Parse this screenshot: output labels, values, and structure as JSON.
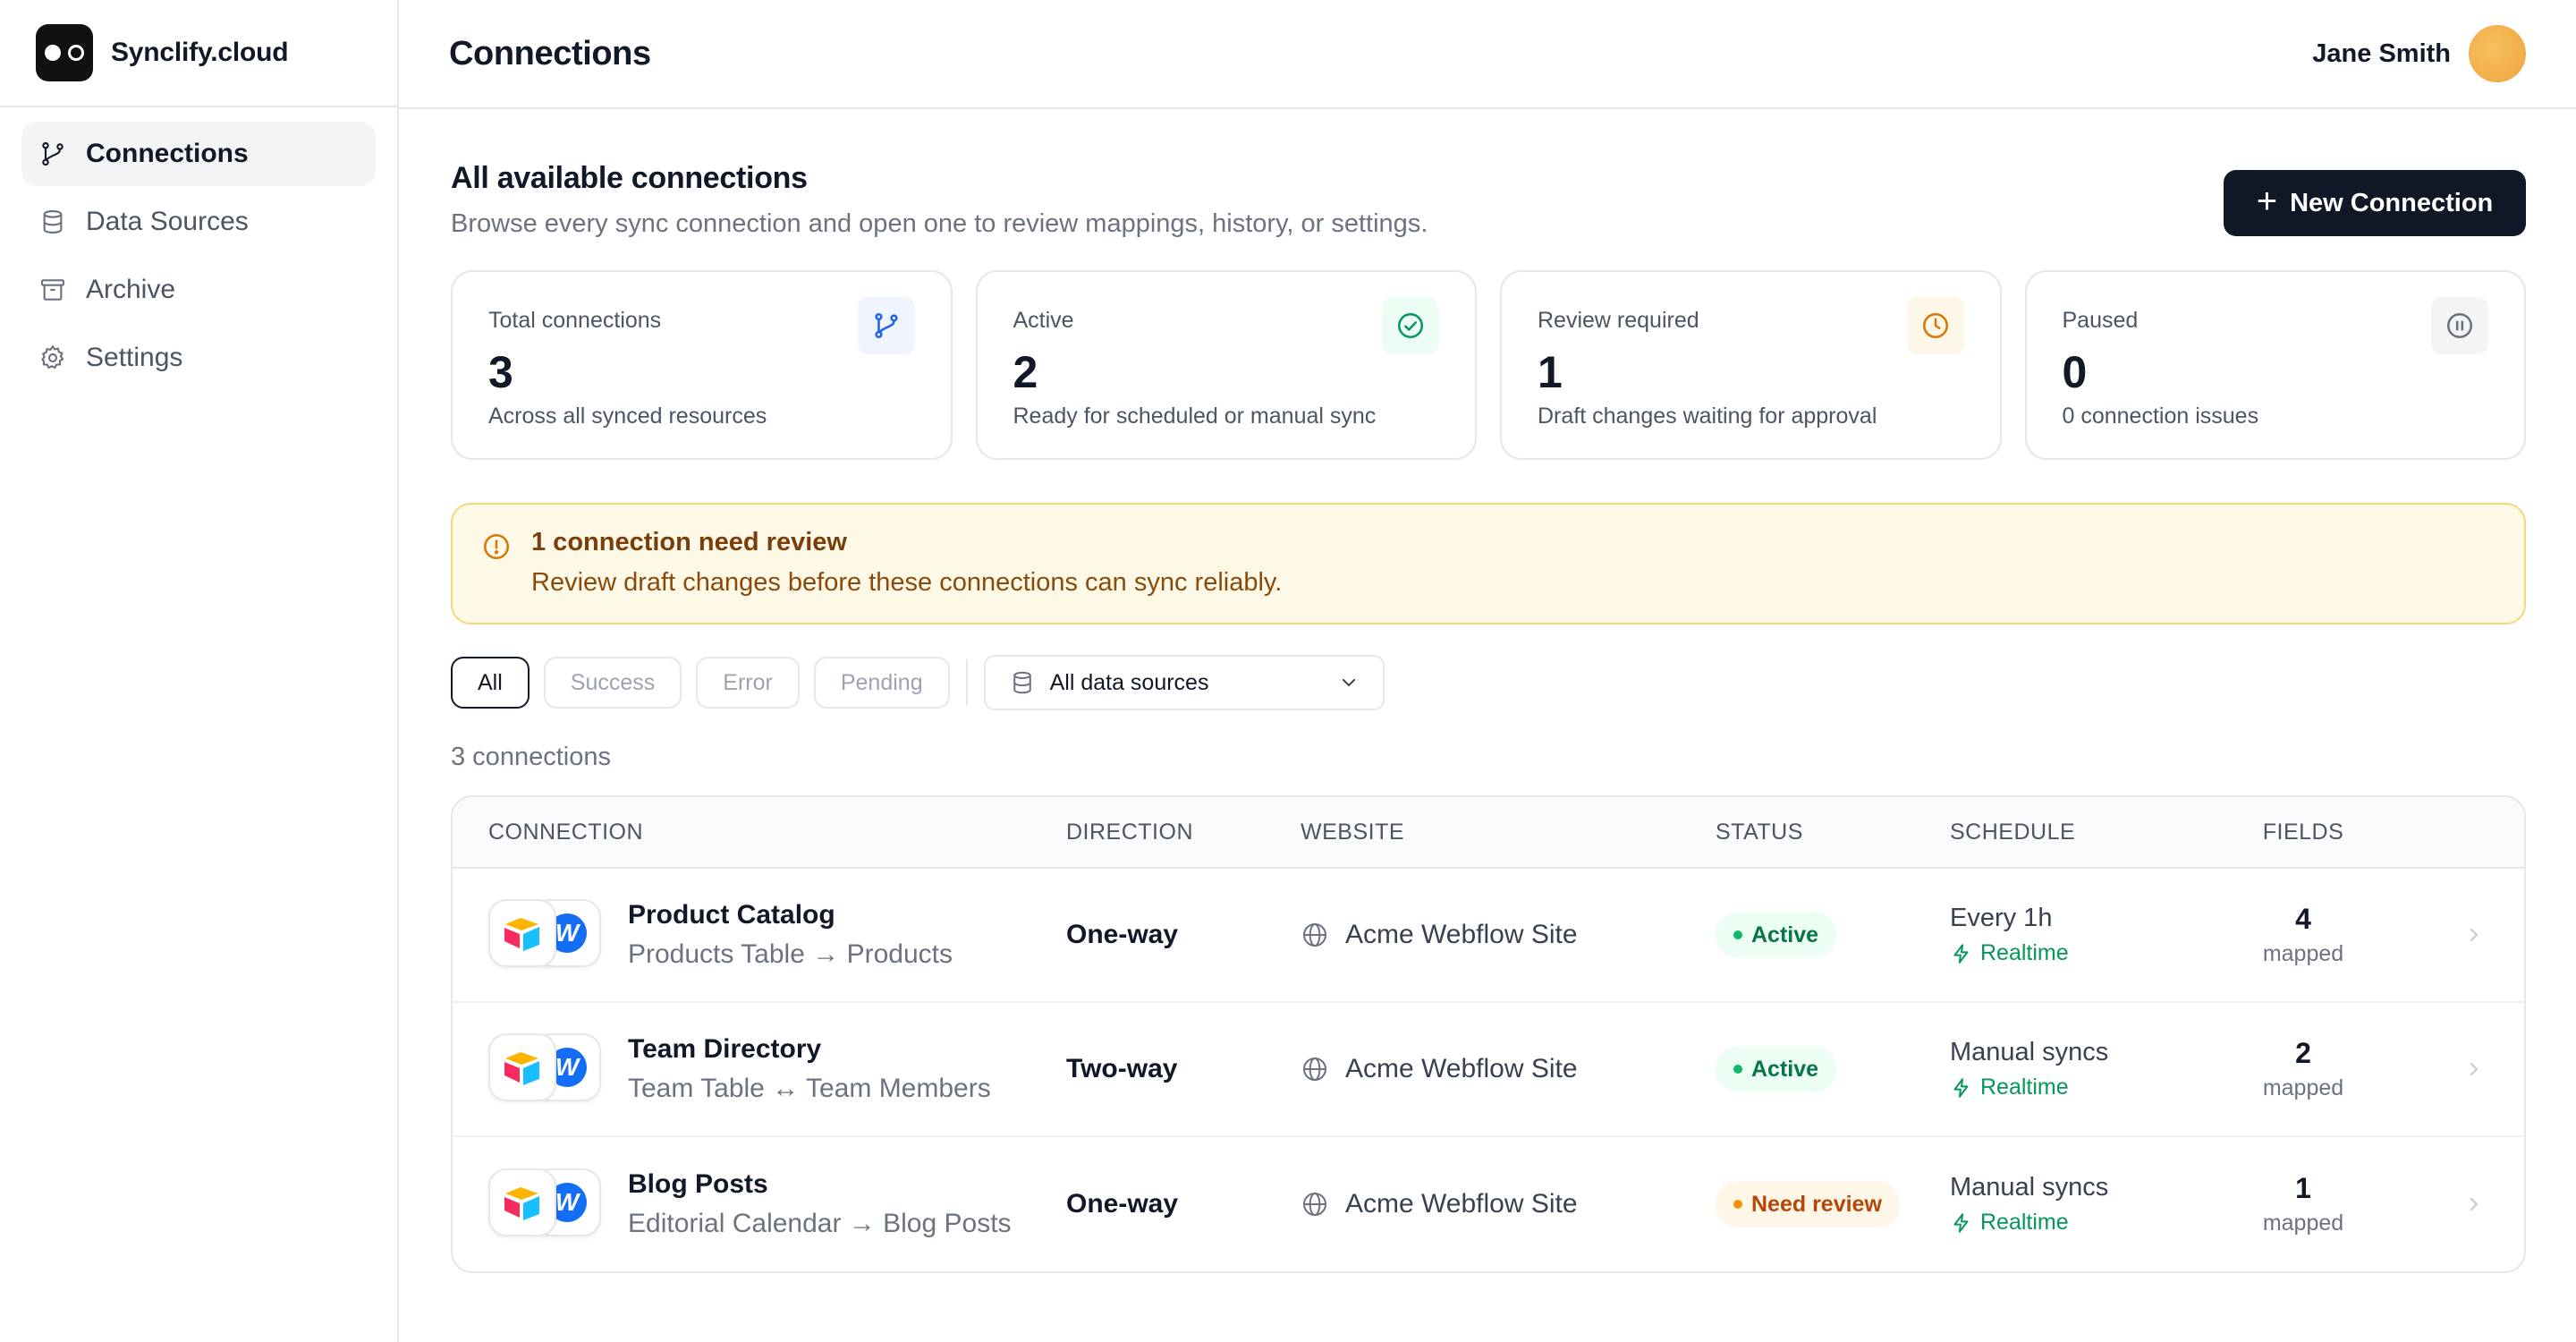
{
  "brand": {
    "name": "Synclify.cloud"
  },
  "sidebar": {
    "items": [
      {
        "label": "Connections",
        "icon": "git-branch-icon",
        "active": true
      },
      {
        "label": "Data Sources",
        "icon": "database-icon",
        "active": false
      },
      {
        "label": "Archive",
        "icon": "archive-icon",
        "active": false
      },
      {
        "label": "Settings",
        "icon": "gear-icon",
        "active": false
      }
    ]
  },
  "header": {
    "title": "Connections",
    "user_name": "Jane Smith"
  },
  "section": {
    "title": "All available connections",
    "subtitle": "Browse every sync connection and open one to review mappings, history, or settings.",
    "new_button": "New Connection"
  },
  "stats": [
    {
      "label": "Total connections",
      "value": "3",
      "desc": "Across all synced resources",
      "icon": "git-branch-icon",
      "color": "#2563eb"
    },
    {
      "label": "Active",
      "value": "2",
      "desc": "Ready for scheduled or manual sync",
      "icon": "check-circle-icon",
      "color": "#059669"
    },
    {
      "label": "Review required",
      "value": "1",
      "desc": "Draft changes waiting for approval",
      "icon": "clock-icon",
      "color": "#d97706"
    },
    {
      "label": "Paused",
      "value": "0",
      "desc": "0 connection issues",
      "icon": "pause-circle-icon",
      "color": "#6b7280"
    }
  ],
  "alert": {
    "title": "1 connection need review",
    "text": "Review draft changes before these connections can sync reliably."
  },
  "filters": {
    "chips": [
      "All",
      "Success",
      "Error",
      "Pending"
    ],
    "active": "All",
    "source_select": "All data sources"
  },
  "count_label": "3 connections",
  "table": {
    "columns": [
      "CONNECTION",
      "DIRECTION",
      "WEBSITE",
      "STATUS",
      "SCHEDULE",
      "FIELDS"
    ],
    "rows": [
      {
        "name": "Product Catalog",
        "mapping": "Products Table → Products",
        "direction": "One-way",
        "website": "Acme Webflow Site",
        "status": "Active",
        "status_kind": "active",
        "schedule": "Every 1h",
        "schedule_sub": "Realtime",
        "fields": "4",
        "fields_sub": "mapped"
      },
      {
        "name": "Team Directory",
        "mapping": "Team Table ↔ Team Members",
        "direction": "Two-way",
        "website": "Acme Webflow Site",
        "status": "Active",
        "status_kind": "active",
        "schedule": "Manual syncs",
        "schedule_sub": "Realtime",
        "fields": "2",
        "fields_sub": "mapped"
      },
      {
        "name": "Blog Posts",
        "mapping": "Editorial Calendar → Blog Posts",
        "direction": "One-way",
        "website": "Acme Webflow Site",
        "status": "Need review",
        "status_kind": "review",
        "schedule": "Manual syncs",
        "schedule_sub": "Realtime",
        "fields": "1",
        "fields_sub": "mapped"
      }
    ]
  }
}
